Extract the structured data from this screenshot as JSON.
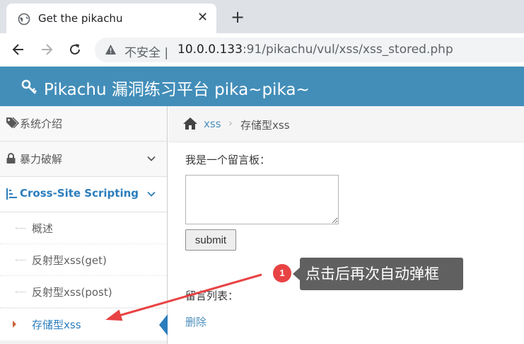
{
  "browser": {
    "tab_title": "Get the pikachu",
    "tab_close": "✕",
    "new_tab": "+",
    "security_label": "不安全",
    "url_host": "10.0.0.133",
    "url_rest": ":91/pikachu/vul/xss/xss_stored.php"
  },
  "header": {
    "title": "Pikachu 漏洞练习平台 pika~pika~",
    "color": "#438eb9"
  },
  "sidebar": {
    "items": [
      {
        "label": "系统介绍",
        "icon": "tags-icon"
      },
      {
        "label": "暴力破解",
        "icon": "lock-icon"
      },
      {
        "label": "Cross-Site Scripting",
        "icon": "list-icon"
      }
    ],
    "subitems": [
      {
        "label": "概述"
      },
      {
        "label": "反射型xss(get)"
      },
      {
        "label": "反射型xss(post)"
      },
      {
        "label": "存储型xss"
      }
    ]
  },
  "breadcrumb": {
    "link": "xss",
    "separator": "›",
    "current": "存储型xss"
  },
  "main": {
    "form_label": "我是一个留言板：",
    "textarea_value": "",
    "submit_label": "submit",
    "list_label": "留言列表：",
    "delete_label": "删除"
  },
  "annotation": {
    "badge": "1",
    "text": "点击后再次自动弹框",
    "arrow_color": "#e84344"
  }
}
